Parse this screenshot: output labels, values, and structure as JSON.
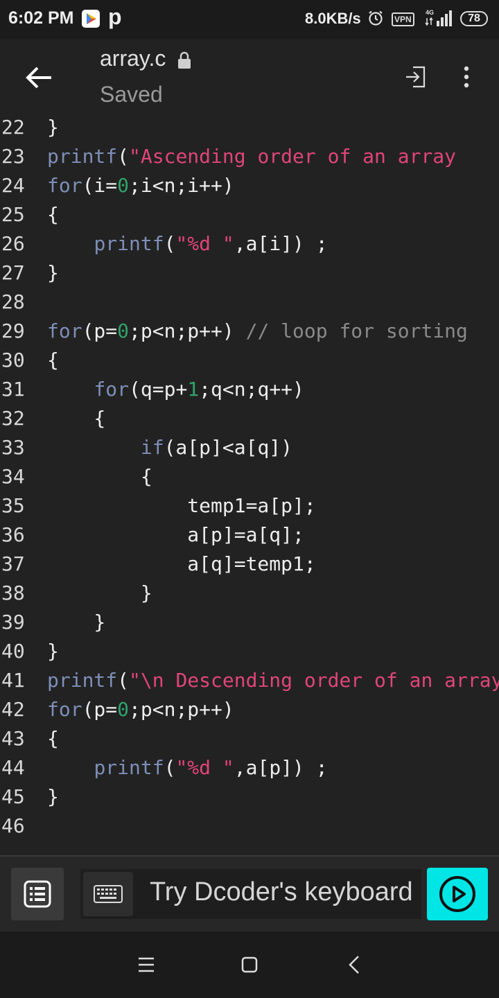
{
  "status_bar": {
    "time": "6:02 PM",
    "notification_letter": "p",
    "net_speed": "8.0KB/s",
    "vpn_label": "VPN",
    "network_type": "4G",
    "battery": "78",
    "icons": [
      "play-store-icon",
      "alarm-icon",
      "signal-icon",
      "battery-icon"
    ]
  },
  "app_bar": {
    "title": "array.c",
    "subtitle": "Saved",
    "icons": [
      "back-arrow-icon",
      "lock-icon",
      "export-icon",
      "more-vert-icon"
    ]
  },
  "editor": {
    "colors": {
      "keyword": "#7e8fb8",
      "string": "#e0457a",
      "number": "#2fa36b",
      "comment": "#8a8a8a",
      "text": "#eeeeee"
    },
    "lines": [
      {
        "n": "22",
        "t": [
          {
            "c": "p",
            "s": "}"
          }
        ]
      },
      {
        "n": "23",
        "t": [
          {
            "c": "kw",
            "s": "printf"
          },
          {
            "c": "p",
            "s": "("
          },
          {
            "c": "str",
            "s": "\"Ascending order of an array"
          }
        ]
      },
      {
        "n": "24",
        "t": [
          {
            "c": "kw",
            "s": "for"
          },
          {
            "c": "p",
            "s": "(i="
          },
          {
            "c": "num",
            "s": "0"
          },
          {
            "c": "p",
            "s": ";i<n;i++)"
          }
        ]
      },
      {
        "n": "25",
        "t": [
          {
            "c": "p",
            "s": "{"
          }
        ]
      },
      {
        "n": "26",
        "t": [
          {
            "c": "p",
            "s": "    "
          },
          {
            "c": "kw",
            "s": "printf"
          },
          {
            "c": "p",
            "s": "("
          },
          {
            "c": "str",
            "s": "\"%d \""
          },
          {
            "c": "p",
            "s": ",a[i]) ;"
          }
        ]
      },
      {
        "n": "27",
        "t": [
          {
            "c": "p",
            "s": "}"
          }
        ]
      },
      {
        "n": "28",
        "t": []
      },
      {
        "n": "29",
        "t": [
          {
            "c": "kw",
            "s": "for"
          },
          {
            "c": "p",
            "s": "(p="
          },
          {
            "c": "num",
            "s": "0"
          },
          {
            "c": "p",
            "s": ";p<n;p++) "
          },
          {
            "c": "cm",
            "s": "// loop for sorting"
          }
        ]
      },
      {
        "n": "30",
        "t": [
          {
            "c": "p",
            "s": "{"
          }
        ]
      },
      {
        "n": "31",
        "t": [
          {
            "c": "p",
            "s": "    "
          },
          {
            "c": "kw",
            "s": "for"
          },
          {
            "c": "p",
            "s": "(q=p+"
          },
          {
            "c": "num",
            "s": "1"
          },
          {
            "c": "p",
            "s": ";q<n;q++)"
          }
        ]
      },
      {
        "n": "32",
        "t": [
          {
            "c": "p",
            "s": "    {"
          }
        ]
      },
      {
        "n": "33",
        "t": [
          {
            "c": "p",
            "s": "        "
          },
          {
            "c": "kw",
            "s": "if"
          },
          {
            "c": "p",
            "s": "(a[p]<a[q])"
          }
        ]
      },
      {
        "n": "34",
        "t": [
          {
            "c": "p",
            "s": "        {"
          }
        ]
      },
      {
        "n": "35",
        "t": [
          {
            "c": "p",
            "s": "            temp1=a[p];"
          }
        ]
      },
      {
        "n": "36",
        "t": [
          {
            "c": "p",
            "s": "            a[p]=a[q];"
          }
        ]
      },
      {
        "n": "37",
        "t": [
          {
            "c": "p",
            "s": "            a[q]=temp1;"
          }
        ]
      },
      {
        "n": "38",
        "t": [
          {
            "c": "p",
            "s": "        }"
          }
        ]
      },
      {
        "n": "39",
        "t": [
          {
            "c": "p",
            "s": "    }"
          }
        ]
      },
      {
        "n": "40",
        "t": [
          {
            "c": "p",
            "s": "}"
          }
        ]
      },
      {
        "n": "41",
        "t": [
          {
            "c": "kw",
            "s": "printf"
          },
          {
            "c": "p",
            "s": "("
          },
          {
            "c": "str",
            "s": "\"\\n Descending order of an array"
          }
        ]
      },
      {
        "n": "42",
        "t": [
          {
            "c": "kw",
            "s": "for"
          },
          {
            "c": "p",
            "s": "(p="
          },
          {
            "c": "num",
            "s": "0"
          },
          {
            "c": "p",
            "s": ";p<n;p++)"
          }
        ]
      },
      {
        "n": "43",
        "t": [
          {
            "c": "p",
            "s": "{"
          }
        ]
      },
      {
        "n": "44",
        "t": [
          {
            "c": "p",
            "s": "    "
          },
          {
            "c": "kw",
            "s": "printf"
          },
          {
            "c": "p",
            "s": "("
          },
          {
            "c": "str",
            "s": "\"%d \""
          },
          {
            "c": "p",
            "s": ",a[p]) ;"
          }
        ]
      },
      {
        "n": "45",
        "t": [
          {
            "c": "p",
            "s": "}"
          }
        ]
      },
      {
        "n": "46",
        "t": []
      }
    ]
  },
  "bottom_bar": {
    "keyboard_prompt": "Try Dcoder's keyboard",
    "accent_color": "#00e5e5",
    "icons": [
      "list-icon",
      "keyboard-icon",
      "run-icon"
    ]
  },
  "nav_bar": {
    "icons": [
      "menu-icon",
      "home-icon",
      "back-icon"
    ]
  }
}
